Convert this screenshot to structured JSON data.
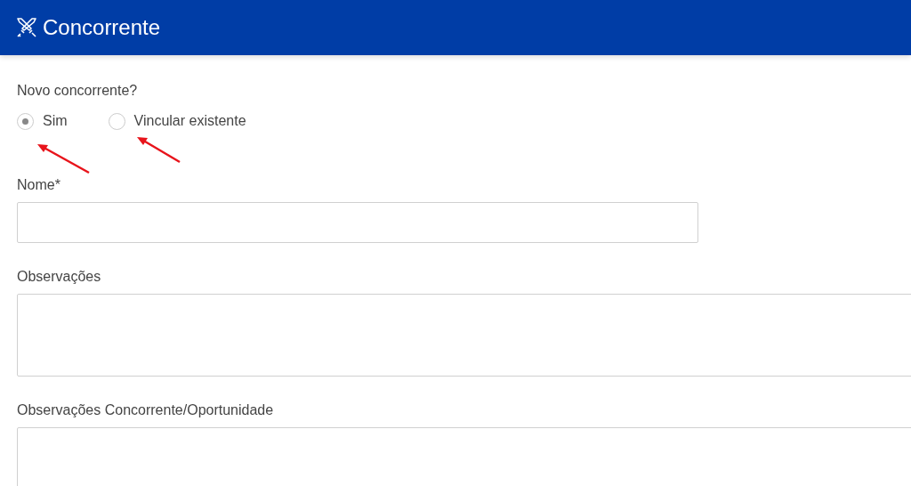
{
  "header": {
    "title": "Concorrente"
  },
  "question": {
    "label": "Novo concorrente?",
    "options": [
      {
        "label": "Sim",
        "selected": true
      },
      {
        "label": "Vincular existente",
        "selected": false
      }
    ]
  },
  "fields": [
    {
      "label": "Nome*",
      "kind": "input"
    },
    {
      "label": "Observações",
      "kind": "textarea"
    },
    {
      "label": "Observações Concorrente/Oportunidade",
      "kind": "textarea"
    }
  ]
}
